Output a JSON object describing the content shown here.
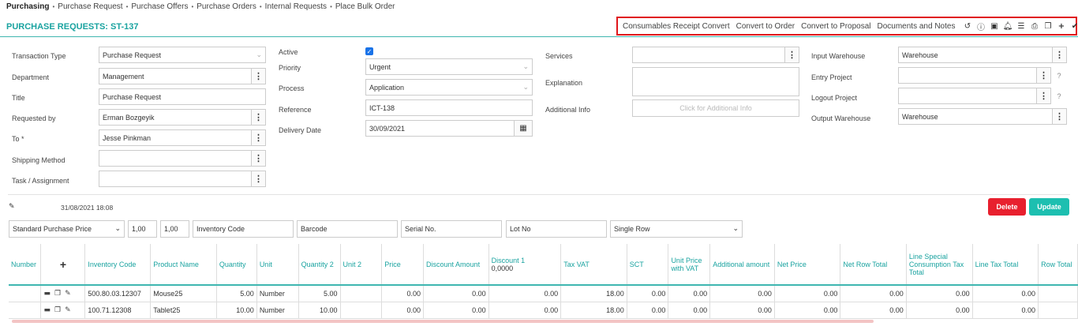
{
  "nav": {
    "items": [
      "Purchasing",
      "Purchase Request",
      "Purchase Offers",
      "Purchase Orders",
      "Internal Requests",
      "Place Bulk Order"
    ],
    "separator": "•"
  },
  "page_title": "PURCHASE REQUESTS: ST-137",
  "toolbar": {
    "links": [
      "Consumables Receipt Convert",
      "Convert to Order",
      "Convert to Proposal",
      "Documents and Notes"
    ],
    "icons": [
      "history-icon",
      "info-icon",
      "box-icon",
      "bell-icon",
      "list-icon",
      "print-icon",
      "copy-icon",
      "plus-icon",
      "check-icon"
    ],
    "highlight_color": "#e0161b"
  },
  "form": {
    "col1": {
      "transaction_type_label": "Transaction Type",
      "transaction_type_value": "Purchase Request",
      "department_label": "Department",
      "department_value": "Management",
      "title_label": "Title",
      "title_value": "Purchase Request",
      "requested_by_label": "Requested by",
      "requested_by_value": "Erman Bozgeyik",
      "to_label": "To *",
      "to_value": "Jesse Pinkman",
      "shipping_method_label": "Shipping Method",
      "shipping_method_value": "",
      "task_label": "Task / Assignment",
      "task_value": ""
    },
    "col2": {
      "active_label": "Active",
      "active_checked": true,
      "priority_label": "Priority",
      "priority_value": "Urgent",
      "process_label": "Process",
      "process_value": "Application",
      "reference_label": "Reference",
      "reference_value": "ICT-138",
      "delivery_date_label": "Delivery Date",
      "delivery_date_value": "30/09/2021"
    },
    "col3": {
      "services_label": "Services",
      "services_value": "",
      "explanation_label": "Explanation",
      "explanation_value": "",
      "additional_info_label": "Additional Info",
      "additional_info_placeholder": "Click for Additional Info"
    },
    "col4": {
      "input_warehouse_label": "Input Warehouse",
      "input_warehouse_value": "Warehouse",
      "entry_project_label": "Entry Project",
      "entry_project_value": "",
      "logout_project_label": "Logout Project",
      "logout_project_value": "",
      "output_warehouse_label": "Output Warehouse",
      "output_warehouse_value": "Warehouse",
      "help_mark": "?"
    }
  },
  "meta": {
    "timestamp": "31/08/2021 18:08"
  },
  "buttons": {
    "delete": "Delete",
    "update": "Update",
    "delete_color": "#e8202e",
    "update_color": "#1dbfb0"
  },
  "entry_bar": {
    "price_type": "Standard Purchase Price",
    "qty1": "1,00",
    "qty2": "1,00",
    "inventory_code_placeholder": "Inventory Code",
    "barcode_placeholder": "Barcode",
    "serial_placeholder": "Serial No.",
    "lot_placeholder": "Lot No",
    "row_mode": "Single Row"
  },
  "table": {
    "headers": {
      "number": "Number",
      "add": "+",
      "inventory_code": "Inventory Code",
      "product_name": "Product Name",
      "quantity": "Quantity",
      "unit": "Unit",
      "quantity2": "Quantity 2",
      "unit2": "Unit 2",
      "price": "Price",
      "discount_amount": "Discount Amount",
      "discount1": "Discount 1",
      "discount1_sub": "0,0000",
      "tax_vat": "Tax VAT",
      "sct": "SCT",
      "unit_price_vat": "Unit Price with VAT",
      "additional_amount": "Additional amount",
      "net_price": "Net Price",
      "net_row_total": "Net Row Total",
      "line_special_tax": "Line Special Consumption Tax Total",
      "line_tax_total": "Line Tax Total",
      "row_total": "Row Total"
    },
    "rows": [
      {
        "number": "",
        "inventory_code": "500.80.03.12307",
        "product_name": "Mouse25",
        "quantity": "5.00",
        "unit": "Number",
        "quantity2": "5.00",
        "unit2": "",
        "price": "0.00",
        "discount_amount": "0.00",
        "discount1": "0.00",
        "tax_vat": "18.00",
        "sct": "0.00",
        "unit_price_vat": "0.00",
        "additional_amount": "0.00",
        "net_price": "0.00",
        "net_row_total": "0.00",
        "line_special_tax": "0.00",
        "line_tax_total": "0.00",
        "row_total": ""
      },
      {
        "number": "",
        "inventory_code": "100.71.12308",
        "product_name": "Tablet25",
        "quantity": "10.00",
        "unit": "Number",
        "quantity2": "10.00",
        "unit2": "",
        "price": "0.00",
        "discount_amount": "0.00",
        "discount1": "0.00",
        "tax_vat": "18.00",
        "sct": "0.00",
        "unit_price_vat": "0.00",
        "additional_amount": "0.00",
        "net_price": "0.00",
        "net_row_total": "0.00",
        "line_special_tax": "0.00",
        "line_tax_total": "0.00",
        "row_total": ""
      }
    ]
  }
}
